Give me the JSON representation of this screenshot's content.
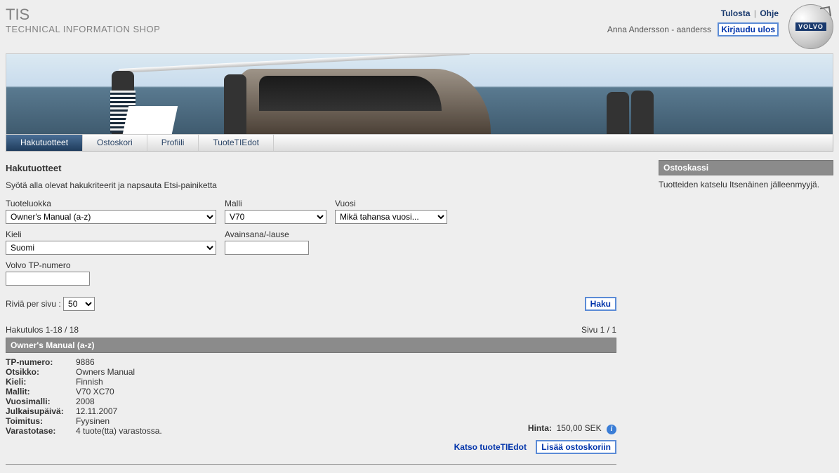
{
  "header": {
    "brand_short": "TIS",
    "brand_long": "TECHNICAL INFORMATION SHOP",
    "print": "Tulosta",
    "help": "Ohje",
    "user_display": "Anna Andersson - aanderss",
    "logout": "Kirjaudu ulos",
    "logo_text": "VOLVO"
  },
  "tabs": {
    "t0": "Hakutuotteet",
    "t1": "Ostoskori",
    "t2": "Profiili",
    "t3": "TuoteTIEdot"
  },
  "page": {
    "title": "Hakutuotteet",
    "subtitle": "Syötä alla olevat hakukriteerit ja napsauta Etsi-painiketta"
  },
  "filters": {
    "category_label": "Tuoteluokka",
    "category_value": "Owner's Manual (a-z)",
    "model_label": "Malli",
    "model_value": "V70",
    "year_label": "Vuosi",
    "year_value": "Mikä tahansa vuosi...",
    "lang_label": "Kieli",
    "lang_value": "Suomi",
    "keyword_label": "Avainsana/-lause",
    "keyword_value": "",
    "tp_label": "Volvo TP-numero",
    "tp_value": "",
    "rows_label": "Riviä per sivu :",
    "rows_value": "50",
    "search_btn": "Haku"
  },
  "results": {
    "summary": "Hakutulos 1-18 / 18",
    "page_info": "Sivu 1 / 1",
    "group_header": "Owner's Manual (a-z)",
    "labels": {
      "tp": "TP-numero:",
      "title": "Otsikko:",
      "lang": "Kieli:",
      "models": "Mallit:",
      "year": "Vuosimalli:",
      "pub": "Julkaisupäivä:",
      "delivery": "Toimitus:",
      "stock": "Varastotase:",
      "price": "Hinta:"
    },
    "item": {
      "tp": "9886",
      "title": "Owners Manual",
      "lang": "Finnish",
      "models": "V70  XC70",
      "year": "2008",
      "pub": "12.11.2007",
      "delivery": "Fyysinen",
      "stock": "4 tuote(tta) varastossa.",
      "price": "150,00 SEK"
    },
    "view_link": "Katso tuoteTIEdot",
    "add_btn": "Lisää ostoskoriin"
  },
  "side": {
    "cart_header": "Ostoskassi",
    "note": "Tuotteiden katselu Itsenäinen jälleenmyyjä."
  }
}
